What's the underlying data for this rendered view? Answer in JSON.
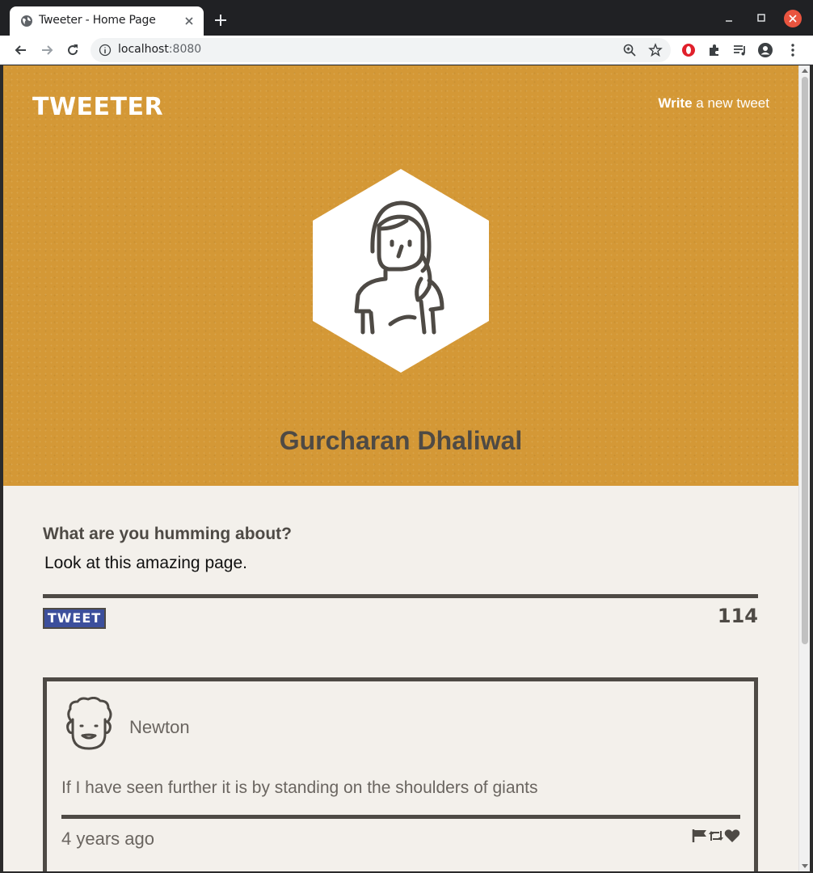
{
  "browser": {
    "tab_title": "Tweeter - Home Page",
    "url_host": "localhost",
    "url_port": ":8080",
    "icons": [
      "globe-icon",
      "close-icon",
      "plus-icon",
      "minimize-icon",
      "maximize-icon",
      "back-icon",
      "forward-icon",
      "reload-icon",
      "info-icon",
      "zoom-icon",
      "star-icon",
      "opera-icon",
      "puzzle-icon",
      "playlist-icon",
      "profile-icon",
      "menu-icon"
    ]
  },
  "header": {
    "logo": "TWEETER",
    "compose_link_bold": "Write",
    "compose_link_rest": " a new tweet"
  },
  "profile": {
    "name": "Gurcharan Dhaliwal"
  },
  "compose": {
    "label": "What are you humming about?",
    "value": "Look at this amazing page.",
    "submit_label": "TWEET",
    "char_count": "114"
  },
  "tweets": [
    {
      "author": "Newton",
      "text": "If I have seen further it is by standing on the shoulders of giants",
      "time": "4 years ago"
    }
  ],
  "colors": {
    "hero": "#d49836",
    "text_dark": "#4e4a45",
    "page_bg": "#f3f0eb",
    "button": "#3c4f9c"
  }
}
